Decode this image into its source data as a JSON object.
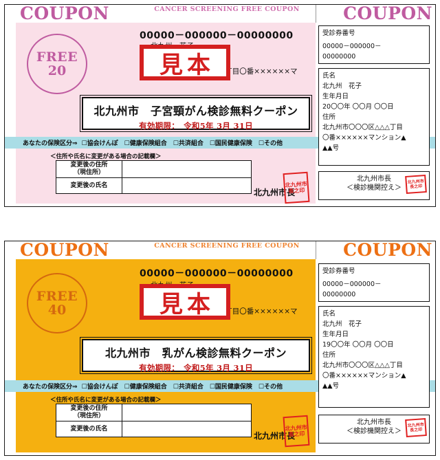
{
  "coupons": [
    {
      "id": "cervical",
      "header": {
        "left_label": "COUPON",
        "center_label": "CANCER SCREENING FREE COUPON",
        "right_label": "COUPON"
      },
      "stamp": {
        "word": "FREE",
        "number": "20"
      },
      "coupon_number": "00000－000000－00000000",
      "holder_name": "北九州　花子",
      "holder_address": "北九州市〇〇〇区△△△丁目〇番××××××マ",
      "sample_stamp": "見本",
      "title": "北九州市　子宮頸がん検診無料クーポン",
      "expiry": "有効期限：　令和5年 3月 31日",
      "insurance": {
        "label": "あなたの保険区分⇒",
        "options": [
          "協会けんぽ",
          "健康保険組合",
          "共済組合",
          "国民健康保険",
          "その他"
        ]
      },
      "change_note": "＜住所や氏名に変更がある場合の記載欄＞",
      "change_rows": [
        {
          "key": "変更後の住所",
          "key2": "（現住所）",
          "value": ""
        },
        {
          "key": "変更後の氏名",
          "key2": "",
          "value": ""
        }
      ],
      "mayor_label": "北九州市長",
      "seal_text": "北九州市長之印",
      "stub": {
        "number_label": "受診券番号",
        "number_line1": "00000－000000－",
        "number_line2": "00000000",
        "name_label": "氏名",
        "name_value": "北九州　花子",
        "birth_label": "生年月日",
        "birth_value": "20〇〇年 〇〇月 〇〇日",
        "address_label": "住所",
        "address_line1": "北九州市〇〇〇区△△△丁目",
        "address_line2": "〇番××××××マンション▲",
        "address_line3": "▲▲号",
        "foot_line1": "北九州市長",
        "foot_line2": "＜検診機関控え＞"
      },
      "colors": {
        "accent": "#bf5ba0",
        "tint": "#fadfe8",
        "band": "#aadde6",
        "title_red": "#c01717"
      }
    },
    {
      "id": "breast",
      "header": {
        "left_label": "COUPON",
        "center_label": "CANCER SCREENING FREE COUPON",
        "right_label": "COUPON"
      },
      "stamp": {
        "word": "FREE",
        "number": "40"
      },
      "coupon_number": "00000－000000－00000000",
      "holder_name": "北九州　花子",
      "holder_address": "北九州市〇〇〇区△△△丁目〇番××××××マ",
      "sample_stamp": "見本",
      "title": "北九州市　乳がん検診無料クーポン",
      "expiry": "有効期限：　令和5年 3月 31日",
      "insurance": {
        "label": "あなたの保険区分⇒",
        "options": [
          "協会けんぽ",
          "健康保険組合",
          "共済組合",
          "国民健康保険",
          "その他"
        ]
      },
      "change_note": "＜住所や氏名に変更がある場合の記載欄＞",
      "change_rows": [
        {
          "key": "変更後の住所",
          "key2": "（現住所）",
          "value": ""
        },
        {
          "key": "変更後の氏名",
          "key2": "",
          "value": ""
        }
      ],
      "mayor_label": "北九州市長",
      "seal_text": "北九州市長之印",
      "stub": {
        "number_label": "受診券番号",
        "number_line1": "00000－000000－",
        "number_line2": "00000000",
        "name_label": "氏名",
        "name_value": "北九州　花子",
        "birth_label": "生年月日",
        "birth_value": "19〇〇年 〇〇月 〇〇日",
        "address_label": "住所",
        "address_line1": "北九州市〇〇〇区△△△丁目",
        "address_line2": "〇番××××××マンション▲",
        "address_line3": "▲▲号",
        "foot_line1": "北九州市長",
        "foot_line2": "＜検診機関控え＞"
      },
      "colors": {
        "accent": "#ed7014",
        "tint": "#f5b010",
        "band": "#aadde6",
        "title_red": "#c01717"
      }
    }
  ]
}
